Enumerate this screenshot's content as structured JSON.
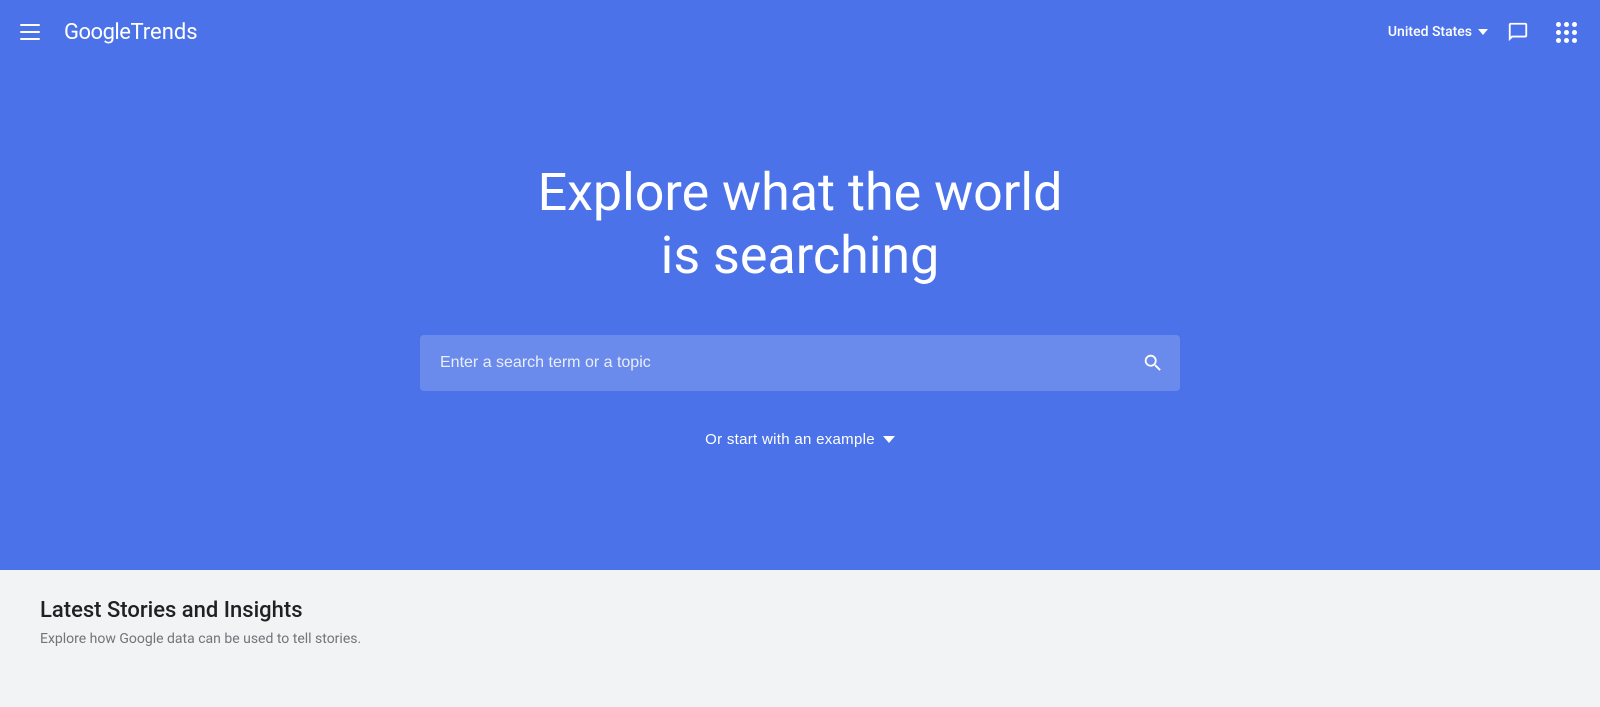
{
  "header": {
    "logo_google": "Google",
    "logo_trends": "Trends",
    "country": "United States",
    "country_selector_label": "United States"
  },
  "hero": {
    "title_line1": "Explore what the world",
    "title_line2": "is searching",
    "search_placeholder": "Enter a search term or a topic",
    "example_label": "Or start with an example"
  },
  "bottom": {
    "stories_title": "Latest Stories and Insights",
    "stories_subtitle": "Explore how Google data can be used to tell stories."
  },
  "colors": {
    "hero_bg": "#4b72e8",
    "page_bg": "#f1f3f4"
  }
}
